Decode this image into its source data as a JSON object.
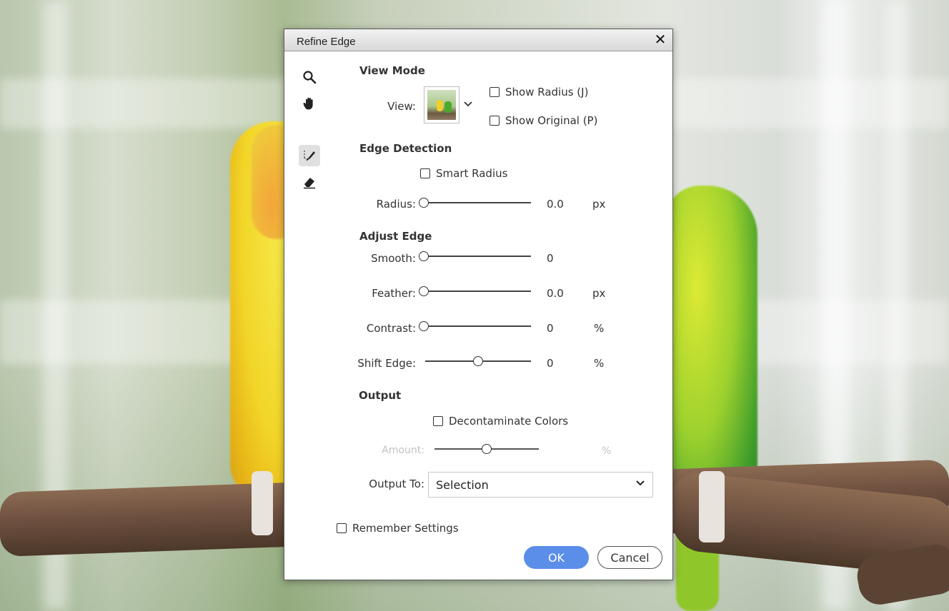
{
  "dialog": {
    "title": "Refine Edge",
    "close_glyph": "✕"
  },
  "tools": [
    {
      "name": "zoom-icon"
    },
    {
      "name": "hand-icon"
    },
    {
      "name": "refine-radius-brush-icon"
    },
    {
      "name": "eraser-icon"
    }
  ],
  "view_mode": {
    "heading": "View Mode",
    "view_label": "View:",
    "show_radius": "Show Radius (J)",
    "show_original": "Show Original (P)"
  },
  "edge_detection": {
    "heading": "Edge Detection",
    "smart_radius": "Smart Radius",
    "radius_label": "Radius:",
    "radius_value": "0.0",
    "radius_unit": "px",
    "radius_level": 0
  },
  "adjust_edge": {
    "heading": "Adjust Edge",
    "smooth_label": "Smooth:",
    "smooth_value": "0",
    "smooth_level": 0,
    "feather_label": "Feather:",
    "feather_value": "0.0",
    "feather_unit": "px",
    "feather_level": 0,
    "contrast_label": "Contrast:",
    "contrast_value": "0",
    "contrast_unit": "%",
    "contrast_level": 0,
    "shift_label": "Shift Edge:",
    "shift_value": "0",
    "shift_unit": "%",
    "shift_level": 0.5
  },
  "output": {
    "heading": "Output",
    "decontaminate": "Decontaminate Colors",
    "amount_label": "Amount:",
    "amount_unit": "%",
    "amount_level": 0.5,
    "output_to_label": "Output To:",
    "output_to_value": "Selection"
  },
  "remember_settings": "Remember Settings",
  "buttons": {
    "ok": "OK",
    "cancel": "Cancel"
  },
  "colors": {
    "ok_button": "#5a8ee8",
    "disabled_text": "#c2c2c2"
  }
}
